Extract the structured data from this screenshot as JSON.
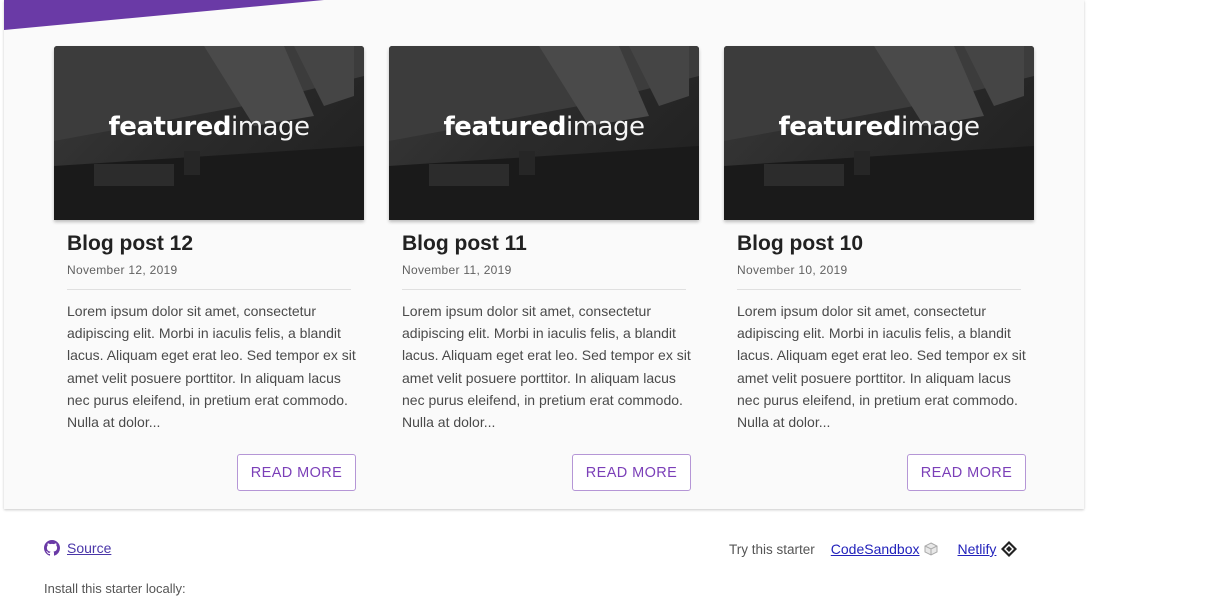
{
  "colors": {
    "accent": "#6a3aa6",
    "button_border": "#b596d6",
    "button_text": "#7b3fb8",
    "link": "#4a36a8"
  },
  "posts": [
    {
      "image_caption_bold": "featured",
      "image_caption_light": "image",
      "title": "Blog post 12",
      "date": "November 12, 2019",
      "excerpt": "Lorem ipsum dolor sit amet, consectetur adipiscing elit. Morbi in iaculis felis, a blandit lacus. Aliquam eget erat leo. Sed tempor ex sit amet velit posuere porttitor. In aliquam lacus nec purus eleifend, in pretium erat commodo. Nulla at dolor...",
      "button_label": "READ MORE"
    },
    {
      "image_caption_bold": "featured",
      "image_caption_light": "image",
      "title": "Blog post 11",
      "date": "November 11, 2019",
      "excerpt": "Lorem ipsum dolor sit amet, consectetur adipiscing elit. Morbi in iaculis felis, a blandit lacus. Aliquam eget erat leo. Sed tempor ex sit amet velit posuere porttitor. In aliquam lacus nec purus eleifend, in pretium erat commodo. Nulla at dolor...",
      "button_label": "READ MORE"
    },
    {
      "image_caption_bold": "featured",
      "image_caption_light": "image",
      "title": "Blog post 10",
      "date": "November 10, 2019",
      "excerpt": "Lorem ipsum dolor sit amet, consectetur adipiscing elit. Morbi in iaculis felis, a blandit lacus. Aliquam eget erat leo. Sed tempor ex sit amet velit posuere porttitor. In aliquam lacus nec purus eleifend, in pretium erat commodo. Nulla at dolor...",
      "button_label": "READ MORE"
    }
  ],
  "footer": {
    "source_label": "Source",
    "source_icon": "github-icon",
    "try_label": "Try this starter",
    "codesandbox_label": "CodeSandbox",
    "codesandbox_icon": "codesandbox-icon",
    "netlify_label": "Netlify",
    "netlify_icon": "netlify-icon",
    "install_text": "Install this starter locally:"
  }
}
